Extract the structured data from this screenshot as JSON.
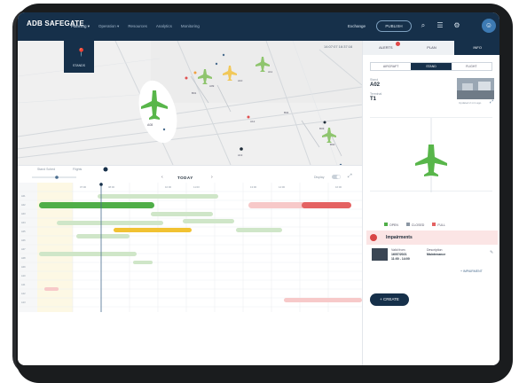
{
  "header": {
    "logo": "ADB SAFEGATE",
    "nav": [
      "Planning ▾",
      "Operation ▾",
      "Resources",
      "Analytics",
      "Monitoring"
    ],
    "exchange": "Exchange",
    "publish": "PUBLISH"
  },
  "map": {
    "time": "14:07:07  16:37:16",
    "stands_button": "STANDS",
    "aircraft_labels": [
      "A08",
      "A09",
      "A10",
      "A11",
      "A12",
      "A13",
      "B01",
      "B02",
      "B03",
      "B04"
    ]
  },
  "right_panel": {
    "tabs": [
      "ALERTS",
      "PLAN",
      "INFO"
    ],
    "segments": [
      "AIRCRAFT",
      "STAND",
      "FLIGHT"
    ],
    "stand_label": "Stand",
    "stand_value": "A02",
    "terminal_label": "Terminal",
    "terminal_value": "T1",
    "photo_caption": "Updated 2 min ago",
    "legend": [
      "OPEN",
      "CLOSED",
      "FULL"
    ],
    "impairments_title": "Impairments",
    "impairment": {
      "col1_head": "Valid from",
      "col1_val": "16/07/2021",
      "col1_time": "11:00 - 14:00",
      "col2_head": "Description",
      "col2_val": "Maintenance"
    },
    "add_impairment": "+ IMPAIRMENT",
    "create_button": "+ CREATE"
  },
  "timeline": {
    "tabs": [
      "Stand Sched",
      "Flights"
    ],
    "today": "TODAY",
    "display_label": "Display"
  },
  "colors": {
    "navy": "#16304a",
    "green": "#4fae48",
    "yellow": "#f1c232",
    "red": "#e46262",
    "light_green": "#cfe6c8"
  }
}
